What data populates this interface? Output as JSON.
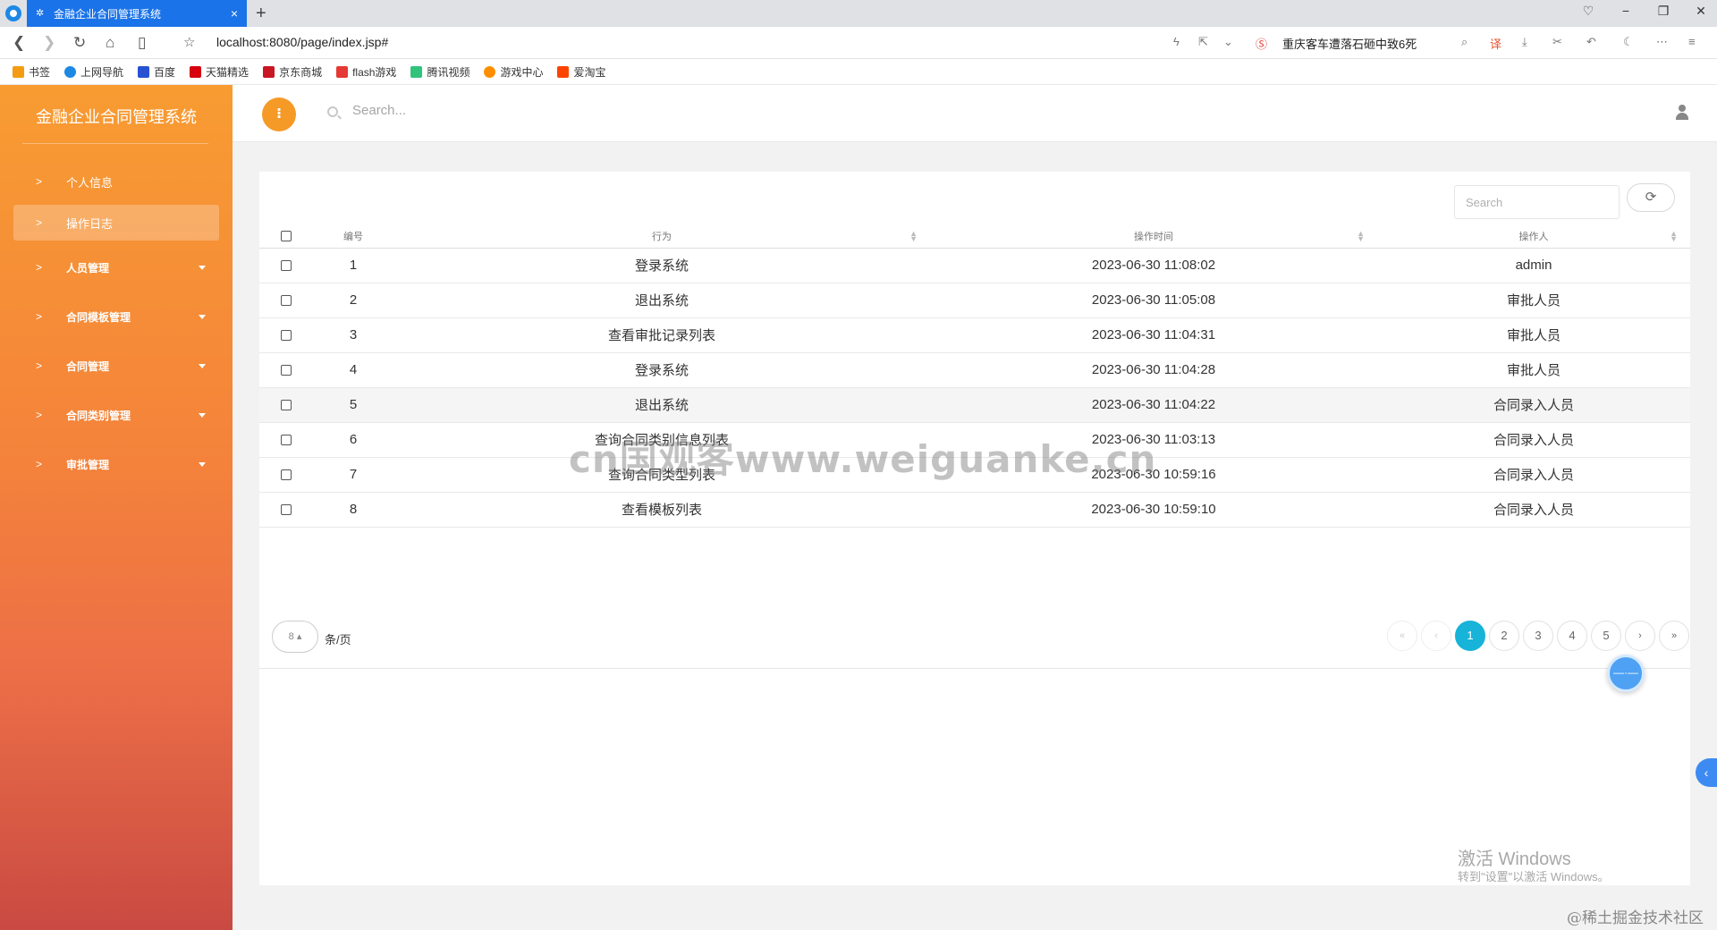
{
  "browser": {
    "tab_title": "金融企业合同管理系统",
    "tab_close": "×",
    "new_tab": "+",
    "address": "localhost:8080/page/index.jsp#",
    "news": "重庆客车遭落石砸中致6死",
    "window_controls": [
      "♡",
      "−",
      "❐",
      "✕"
    ],
    "bookmarks": [
      {
        "label": "书签",
        "color": "#f39c12"
      },
      {
        "label": "上网导航",
        "color": "#1e88e5"
      },
      {
        "label": "百度",
        "color": "#2952d3"
      },
      {
        "label": "天猫精选",
        "color": "#d7000f"
      },
      {
        "label": "京东商城",
        "color": "#c81623"
      },
      {
        "label": "flash游戏",
        "color": "#e53935"
      },
      {
        "label": "腾讯视频",
        "color": "#31c27c"
      },
      {
        "label": "游戏中心",
        "color": "#ff8f00"
      },
      {
        "label": "爱淘宝",
        "color": "#ff4400"
      }
    ]
  },
  "sidebar": {
    "title": "金融企业合同管理系统",
    "items": [
      {
        "label": "个人信息",
        "active": false,
        "dropdown": false
      },
      {
        "label": "操作日志",
        "active": true,
        "dropdown": false
      },
      {
        "label": "人员管理",
        "active": false,
        "dropdown": true
      },
      {
        "label": "合同模板管理",
        "active": false,
        "dropdown": true
      },
      {
        "label": "合同管理",
        "active": false,
        "dropdown": true
      },
      {
        "label": "合同类别管理",
        "active": false,
        "dropdown": true
      },
      {
        "label": "审批管理",
        "active": false,
        "dropdown": true
      }
    ]
  },
  "topbar": {
    "search_placeholder": "Search..."
  },
  "table": {
    "search_placeholder": "Search",
    "columns": [
      "编号",
      "行为",
      "操作时间",
      "操作人"
    ],
    "rows": [
      {
        "id": "1",
        "action": "登录系统",
        "time": "2023-06-30 11:08:02",
        "operator": "admin"
      },
      {
        "id": "2",
        "action": "退出系统",
        "time": "2023-06-30 11:05:08",
        "operator": "审批人员"
      },
      {
        "id": "3",
        "action": "查看审批记录列表",
        "time": "2023-06-30 11:04:31",
        "operator": "审批人员"
      },
      {
        "id": "4",
        "action": "登录系统",
        "time": "2023-06-30 11:04:28",
        "operator": "审批人员"
      },
      {
        "id": "5",
        "action": "退出系统",
        "time": "2023-06-30 11:04:22",
        "operator": "合同录入人员"
      },
      {
        "id": "6",
        "action": "查询合同类别信息列表",
        "time": "2023-06-30 11:03:13",
        "operator": "合同录入人员"
      },
      {
        "id": "7",
        "action": "查询合同类型列表",
        "time": "2023-06-30 10:59:16",
        "operator": "合同录入人员"
      },
      {
        "id": "8",
        "action": "查看模板列表",
        "time": "2023-06-30 10:59:10",
        "operator": "合同录入人员"
      }
    ],
    "highlighted_row": 5
  },
  "pagination": {
    "page_size": "8",
    "page_size_suffix": "条/页",
    "first": "«",
    "prev": "‹",
    "pages": [
      "1",
      "2",
      "3",
      "4",
      "5"
    ],
    "current": "1",
    "next": "›",
    "last": "»"
  },
  "overlays": {
    "watermark": "cn国观客www.weiguanke.cn",
    "activate_title": "激活 Windows",
    "activate_sub": "转到\"设置\"以激活 Windows。",
    "credit": "@稀土掘金技术社区"
  },
  "colors": {
    "accent_orange": "#f59a27",
    "active_page": "#17b3d8",
    "browser_tab": "#1a73e8"
  }
}
